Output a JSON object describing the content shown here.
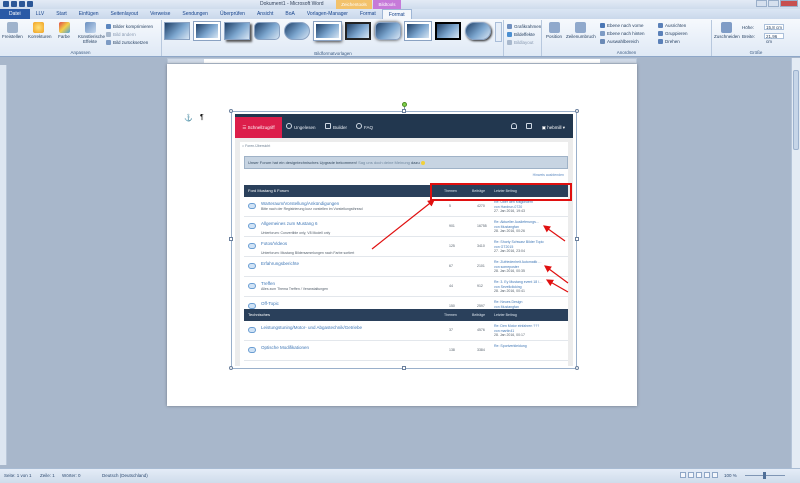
{
  "window": {
    "title": "Dokument1 - Microsoft Word",
    "context_tab_1": "Zeichentools",
    "context_tab_2": "Bildtools"
  },
  "tabs": [
    "Datei",
    "LLV",
    "Start",
    "Einfügen",
    "Seitenlayout",
    "Verweise",
    "Sendungen",
    "Überprüfen",
    "Ansicht",
    "BoA",
    "Vorlagen-Manager",
    "Format",
    "Format"
  ],
  "ribbon": {
    "freistellen": "Freistellen",
    "korrekturen": "Korrekturen",
    "farbe": "Farbe",
    "kuenstlerische_effekte": "Künstlerische Effekte",
    "bilder_komprimieren": "Bilder komprimieren",
    "bild_aendern": "Bild ändern",
    "bild_zuruecksetzen": "Bild zurücksetzen",
    "anpassen_label": "Anpassen",
    "bildformatvorlagen_label": "Bildformatvorlagen",
    "grafikrahmen": "Grafikrahmen",
    "bildeffekte": "Bildeffekte",
    "bildlayout": "Bildlayout",
    "position": "Position",
    "zeilenumbruch": "Zeilenumbruch",
    "ebene_vorne": "Ebene nach vorne",
    "ebene_hinten": "Ebene nach hinten",
    "auswahlbereich": "Auswahlbereich",
    "ausrichten": "Ausrichten",
    "gruppieren": "Gruppieren",
    "drehen": "Drehen",
    "anordnen_label": "Anordnen",
    "zuschneiden": "Zuschneiden",
    "hoehe_label": "Höhe:",
    "hoehe_value": "15,8 cm",
    "breite_label": "Breite:",
    "breite_value": "21,96 cm",
    "groesse_label": "Größe"
  },
  "document": {
    "anchor_glyph": "⚓",
    "pilcrow": "¶"
  },
  "forum": {
    "nav": {
      "quick": "Schnellzugriff",
      "unread": "Ungelesen",
      "builder": "Builder",
      "faq": "FAQ",
      "user": "hebmill"
    },
    "breadcrumb": "Foren-Übersicht",
    "banner_text": "Unser Forum hat ein designtechnisches Upgrade bekommen!",
    "banner_link": "Sag uns doch deine Meinung",
    "banner_after": "dazu",
    "dismiss": "Hinweis ausblenden",
    "section1": {
      "name": "Ford Mustang 6 Forum",
      "col_threads": "Themen",
      "col_posts": "Beiträge",
      "col_last": "Letzter Beitrag"
    },
    "rows1": [
      {
        "name": "Warteraum/Vorstellung/Ankündigungen",
        "desc": "Bitte nach der Registrierung kurz vorstellen im Vorstellungsthread",
        "sub": "",
        "threads": "5",
        "posts": "4270",
        "last1": "Re: Über den Mitgliedern",
        "last2": "von Hardrun-0720",
        "last3": "27. Jan 2016, 19:43"
      },
      {
        "name": "Allgemeines zum Mustang 6",
        "desc": "",
        "sub": "Unterforum: Convertible only, V8 Modell only",
        "threads": "901",
        "posts": "16755",
        "last1": "Re: Aktueller Auslieferungs…",
        "last2": "von Mustangfan",
        "last3": "28. Jan 2016, 00:26"
      },
      {
        "name": "Fotos/Videos",
        "desc": "",
        "sub": "Unterforum: Mustang Bildersammlungen nach Farbe sortiert",
        "threads": "125",
        "posts": "3410",
        "last1": "Re: Shorty Schwarz Bilder Topic",
        "last2": "von GT2015",
        "last3": "27. Jan 2016, 23:04"
      },
      {
        "name": "Erfahrungsberichte",
        "desc": "",
        "sub": "",
        "threads": "67",
        "posts": "2101",
        "last1": "Re: Zufriedenheit Automatik …",
        "last2": "von someposter",
        "last3": "28. Jan 2016, 00:35"
      },
      {
        "name": "Treffen",
        "desc": "Alles zum Thema Treffen / Veranstaltungen",
        "sub": "",
        "threads": "44",
        "posts": "912",
        "last1": "Re: 3. Ey Mustang event 18 /…",
        "last2": "von Sevellclicking",
        "last3": "28. Jan 2016, 00:41"
      },
      {
        "name": "Off-Topic",
        "desc": "",
        "sub": "",
        "threads": "150",
        "posts": "2597",
        "last1": "Re: Neues Design",
        "last2": "von Mustangfan",
        "last3": "28. Jan 2016, 00:13"
      }
    ],
    "section2": {
      "name": "Technisches",
      "col_threads": "Themen",
      "col_posts": "Beiträge",
      "col_last": "Letzter Beitrag"
    },
    "rows2": [
      {
        "name": "Leistungstuning/Motor- und Abgastechnik/Getriebe",
        "desc": "",
        "sub": "",
        "threads": "37",
        "posts": "4576",
        "last1": "Re: Den Motor einfahren ???",
        "last2": "von martin41",
        "last3": "28. Jan 2016, 00:17"
      },
      {
        "name": "Optische Modifikationen",
        "desc": "",
        "sub": "",
        "threads": "138",
        "posts": "3384",
        "last1": "Re: Sportverkleidung",
        "last2": "",
        "last3": ""
      }
    ]
  },
  "status": {
    "seite": "Seite: 1 von 1",
    "zeile": "Zeile: 1",
    "woerter": "Wörter: 0",
    "sprache": "Deutsch (Deutschland)",
    "zoom": "100 %"
  },
  "colors": {
    "accent_red": "#dc1e4b",
    "forum_nav": "#22374f",
    "annotation_red": "#e01010"
  }
}
